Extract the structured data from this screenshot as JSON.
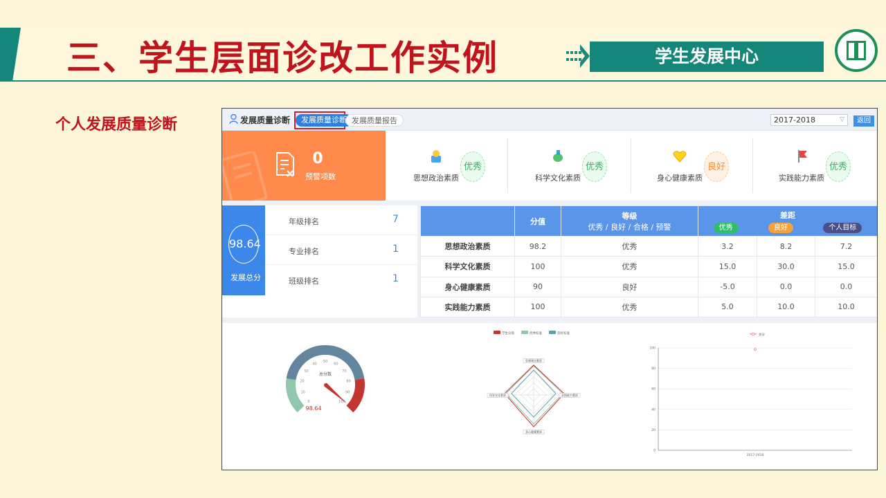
{
  "slide": {
    "title": "三、学生层面诊改工作实例",
    "center_badge": "学生发展中心",
    "subtitle": "个人发展质量诊断"
  },
  "app": {
    "title": "发展质量诊断",
    "tabs": [
      "发展质量诊断",
      "发展质量报告"
    ],
    "year_select": "2017-2018",
    "back_label": "返回",
    "warning": {
      "count": "0",
      "label": "预警项数"
    },
    "qualities": [
      {
        "label": "思想政治素质",
        "grade": "优秀",
        "color": "#36b45e",
        "icon": "medal-icon"
      },
      {
        "label": "科学文化素质",
        "grade": "优秀",
        "color": "#36b45e",
        "icon": "flask-icon"
      },
      {
        "label": "身心健康素质",
        "grade": "良好",
        "color": "#ff8a24",
        "icon": "heart-icon"
      },
      {
        "label": "实践能力素质",
        "grade": "优秀",
        "color": "#36b45e",
        "icon": "flag-icon"
      }
    ],
    "total_score": {
      "value": "98.64",
      "label": "发展总分"
    },
    "rankings": [
      {
        "label": "年级排名",
        "value": "7"
      },
      {
        "label": "专业排名",
        "value": "1"
      },
      {
        "label": "班级排名",
        "value": "1"
      }
    ],
    "table": {
      "header_score": "分值",
      "header_grade": "等级",
      "header_grade_sub": "优秀 / 良好 / 合格 / 预警",
      "header_gap": "差距",
      "gap_pills": [
        {
          "label": "优秀",
          "color": "#2fbf6a"
        },
        {
          "label": "良好",
          "color": "#f5a23a"
        },
        {
          "label": "个人目标",
          "color": "#4a4f8a"
        }
      ],
      "rows": [
        {
          "name": "思想政治素质",
          "score": "98.2",
          "grade": "优秀",
          "gap_excellent": "3.2",
          "gap_good": "8.2",
          "gap_target": "7.2"
        },
        {
          "name": "科学文化素质",
          "score": "100",
          "grade": "优秀",
          "gap_excellent": "15.0",
          "gap_good": "30.0",
          "gap_target": "15.0"
        },
        {
          "name": "身心健康素质",
          "score": "90",
          "grade": "良好",
          "gap_excellent": "-5.0",
          "gap_good": "0.0",
          "gap_target": "0.0"
        },
        {
          "name": "实践能力素质",
          "score": "100",
          "grade": "优秀",
          "gap_excellent": "5.0",
          "gap_good": "10.0",
          "gap_target": "10.0"
        }
      ]
    },
    "gauge": {
      "label": "总分数",
      "value": 98.64,
      "value_text": "98.64",
      "min": 0,
      "max": 100,
      "ticks": [
        "0",
        "10",
        "20",
        "30",
        "40",
        "50",
        "60",
        "70",
        "80",
        "90",
        "100"
      ]
    }
  },
  "chart_data": [
    {
      "type": "radar",
      "legend": [
        "学生分值",
        "优秀标准",
        "良好标准"
      ],
      "legend_colors": [
        "#c23531",
        "#91c7ae",
        "#61a0a8"
      ],
      "axes": [
        "思想政治素质",
        "实践能力素质",
        "身心健康素质",
        "科学文化素质"
      ]
    },
    {
      "type": "line",
      "legend": [
        "总分"
      ],
      "categories": [
        "2017-2018"
      ],
      "series": [
        {
          "name": "总分",
          "values": [
            98.64
          ]
        }
      ],
      "ylim": [
        0,
        100
      ],
      "yticks": [
        "0",
        "20",
        "40",
        "60",
        "80",
        "100"
      ],
      "grid": true,
      "line_color": "#e05a5a"
    }
  ]
}
